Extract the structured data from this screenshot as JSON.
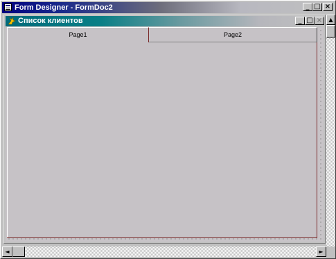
{
  "outer_window": {
    "title": "Form Designer - FormDoc2",
    "icon": "form-designer-icon",
    "buttons": {
      "minimize": "_",
      "maximize": "□",
      "close": "×"
    }
  },
  "form_window": {
    "title": "Список клиентов",
    "icon": "fox-icon",
    "buttons": {
      "minimize": "_",
      "maximize": "□",
      "close": "×"
    }
  },
  "pageframe": {
    "tabs": [
      {
        "label": "Page1"
      },
      {
        "label": "Page2"
      }
    ]
  },
  "scrollbars": {
    "left_arrow": "◄",
    "right_arrow": "►",
    "up_arrow": "▲",
    "down_arrow": "▼"
  },
  "colors": {
    "active_title": "#000080",
    "form_title": "#006a7a",
    "face": "#c0c0c0"
  }
}
